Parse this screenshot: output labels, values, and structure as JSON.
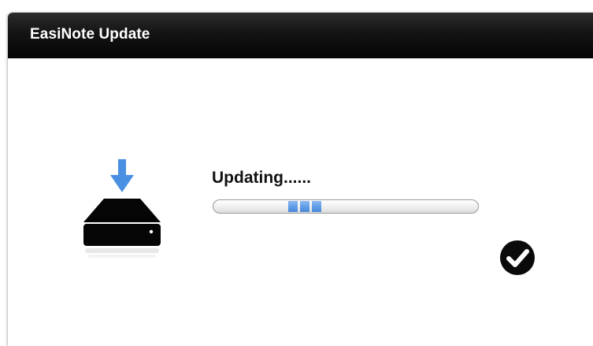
{
  "window": {
    "title": "EasiNote Update"
  },
  "update": {
    "status_text": "Updating......",
    "progress_indicator": "indeterminate",
    "accent_color": "#5c9ae6",
    "icons": {
      "drive": "hard-drive-download-icon",
      "complete": "checkmark-circle-icon"
    }
  }
}
